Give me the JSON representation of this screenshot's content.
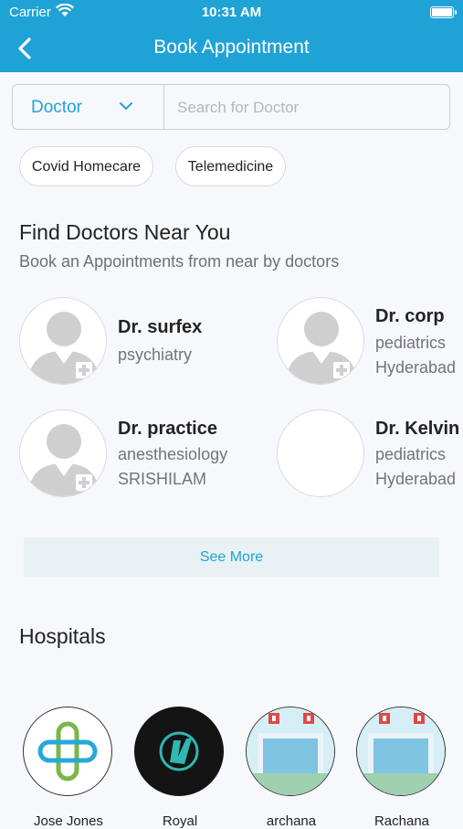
{
  "status_bar": {
    "carrier": "Carrier",
    "time": "10:31 AM"
  },
  "header": {
    "title": "Book Appointment"
  },
  "search": {
    "category": "Doctor",
    "placeholder": "Search for Doctor"
  },
  "chips": [
    "Covid Homecare",
    "Telemedicine"
  ],
  "doctors_section": {
    "title": "Find Doctors Near You",
    "subtitle": "Book an Appointments from near by doctors",
    "doctors": [
      {
        "name": "Dr. surfex",
        "specialty": "psychiatry",
        "location": ""
      },
      {
        "name": "Dr. corp",
        "specialty": "pediatrics",
        "location": "Hyderabad"
      },
      {
        "name": "Dr. practice",
        "specialty": "anesthesiology",
        "location": "SRISHILAM"
      },
      {
        "name": "Dr. Kelvin",
        "specialty": "pediatrics",
        "location": "Hyderabad"
      }
    ],
    "see_more": "See More"
  },
  "hospitals_section": {
    "title": "Hospitals",
    "hospitals": [
      {
        "name": "Jose Jones"
      },
      {
        "name": "Royal"
      },
      {
        "name": "archana"
      },
      {
        "name": "Rachana"
      }
    ]
  },
  "colors": {
    "primary": "#1fa3d6",
    "background": "#f7f8fc",
    "see_more_bg": "#e8f2f4"
  }
}
